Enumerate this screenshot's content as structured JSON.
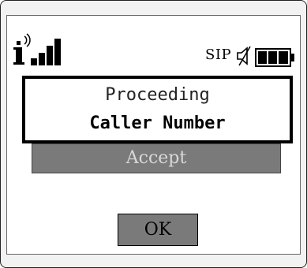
{
  "status_bar": {
    "protocol_label": "SIP",
    "icons": [
      "info-signal-icon",
      "mute-icon",
      "battery-icon"
    ]
  },
  "call": {
    "status": "Proceeding",
    "caller": "Caller Number"
  },
  "options": {
    "accept_label": "Accept"
  },
  "softkey": {
    "ok_label": "OK"
  },
  "colors": {
    "screen_bg": "#ffffff",
    "frame_bg": "#f2f2f2",
    "highlight_bg": "#7a7a7a",
    "highlight_text": "#d8d8d8"
  }
}
